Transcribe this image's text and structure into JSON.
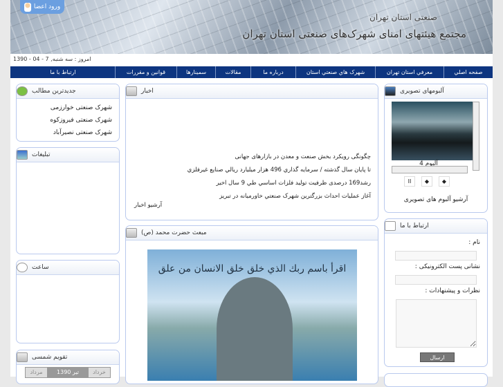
{
  "header": {
    "title": "مجتمع هیئتهای امنای شهرک‌های صنعتی استان تهران",
    "subtitle": "صنعتی استان تهران",
    "login_label": "ورود اعضا",
    "date": "امروز : سه شنبه, 7 - 04 - 1390"
  },
  "nav": [
    "صفحه اصلي",
    "معرفي استان تهران",
    "شهرک هاي صنعتي استان",
    "درباره ما",
    "مقالات",
    "سمينارها",
    "قوانين و مقررات",
    "ارتباط با ما"
  ],
  "latest": {
    "title": "جديدترين مطالب",
    "items": [
      "شهرک صنعتی خوارزمی",
      "شهرک صنعتی فیروزکوه",
      "شهرک صنعتی نصیرآباد"
    ]
  },
  "ads": {
    "title": "تبليغات"
  },
  "clock": {
    "title": "ساعت"
  },
  "calendar": {
    "title": "تقويم شمسی",
    "prev": "خرداد",
    "current": "1390 تیر",
    "next": "مرداد"
  },
  "news": {
    "title": "اخبار",
    "items": [
      "چگونگی رویکرد بخش صنعت و معدن در بازارهای جهانی",
      "تا پایان سال گذشته / سرمایه گذاري 496 هزار میلیارد ریالي صنایع غیرفلزي",
      "رشد169 درصدی ظرفیت تولید فلزات اساسي طي 9 سال اخیر",
      "آغاز عملیات احداث بزرگترین شهرک صنعتي خاورمیانه در تبریز"
    ],
    "archive": "آرشيو اخبار"
  },
  "mabath": {
    "title": "مبعث حضرت محمد (ص)",
    "image_text": "اقرأ باسم ربك الذي خلق    خلق الانسان من علق"
  },
  "albums": {
    "title": "آلبومهای تصویری",
    "caption": "آلبوم 4",
    "archive": "آرشیو آلبوم های تصویری"
  },
  "contact": {
    "title": "ارتباط با ما",
    "name_label": "نام :",
    "email_label": "نشانی پست الکترونیکی :",
    "comments_label": "نظرات و پیشنهادات :",
    "submit": "ارسال"
  }
}
